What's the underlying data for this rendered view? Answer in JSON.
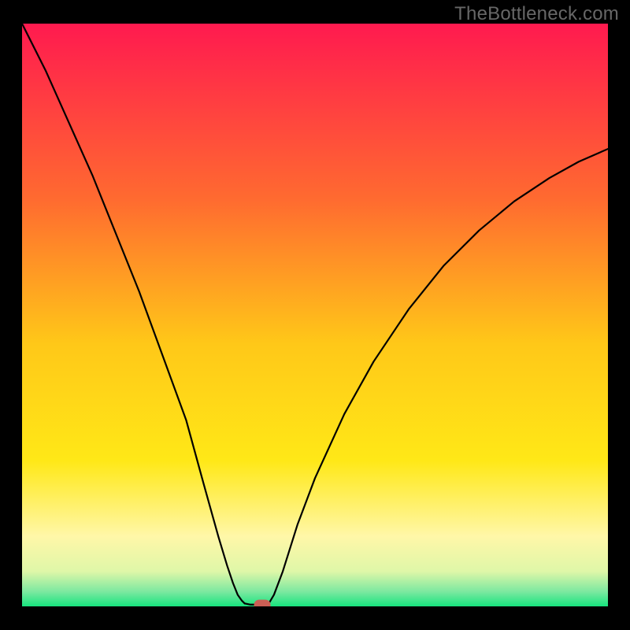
{
  "watermark": "TheBottleneck.com",
  "chart_data": {
    "type": "line",
    "title": "",
    "xlabel": "",
    "ylabel": "",
    "xlim": [
      0,
      100
    ],
    "ylim": [
      0,
      100
    ],
    "background_gradient": [
      {
        "stop": 0.0,
        "color": "#ff1a4f"
      },
      {
        "stop": 0.3,
        "color": "#ff6a30"
      },
      {
        "stop": 0.55,
        "color": "#ffc818"
      },
      {
        "stop": 0.75,
        "color": "#ffe817"
      },
      {
        "stop": 0.88,
        "color": "#fff7a8"
      },
      {
        "stop": 0.94,
        "color": "#dff7a8"
      },
      {
        "stop": 0.975,
        "color": "#7be8a0"
      },
      {
        "stop": 1.0,
        "color": "#17e47e"
      }
    ],
    "series": [
      {
        "name": "bottleneck-curve-left",
        "x": [
          0,
          4,
          8,
          12,
          16,
          20,
          24,
          28,
          31,
          33.5,
          35.0,
          36.0,
          36.8,
          37.5,
          38.0
        ],
        "y": [
          100,
          92,
          83,
          74,
          64,
          54,
          43,
          32,
          21,
          12,
          7.0,
          4.0,
          2.0,
          1.0,
          0.5
        ]
      },
      {
        "name": "bottleneck-curve-flat",
        "x": [
          38.0,
          39.0,
          40.5,
          42.0
        ],
        "y": [
          0.5,
          0.3,
          0.3,
          0.3
        ]
      },
      {
        "name": "bottleneck-curve-right",
        "x": [
          42.0,
          43.0,
          44.5,
          47.0,
          50.0,
          55.0,
          60.0,
          66.0,
          72.0,
          78.0,
          84.0,
          90.0,
          95.0,
          100.0
        ],
        "y": [
          0.3,
          2.0,
          6.0,
          14.0,
          22.0,
          33.0,
          42.0,
          51.0,
          58.5,
          64.5,
          69.5,
          73.5,
          76.3,
          78.5
        ]
      }
    ],
    "marker": {
      "x": 41.0,
      "y": 0.0,
      "color": "#cb5f55"
    },
    "grid": false,
    "legend": false
  }
}
